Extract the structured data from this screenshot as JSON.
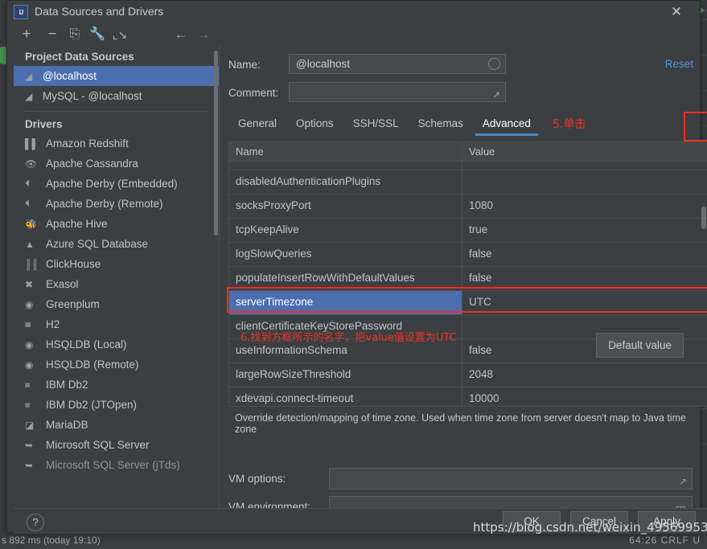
{
  "window": {
    "title": "Data Sources and Drivers",
    "app_icon": "IJ",
    "close_icon": "close-icon"
  },
  "toolbar": {
    "icons": [
      {
        "name": "add-icon",
        "glyph": "+"
      },
      {
        "name": "remove-icon",
        "glyph": "−"
      },
      {
        "name": "copy-icon",
        "glyph": "⎘"
      },
      {
        "name": "wrench-icon",
        "glyph": "ὒ7"
      },
      {
        "name": "import-icon",
        "glyph": "⬋"
      },
      {
        "name": "back-arrow-icon",
        "glyph": "←"
      },
      {
        "name": "forward-arrow-icon",
        "glyph": "→"
      }
    ]
  },
  "sidebar": {
    "project_group_label": "Project Data Sources",
    "data_sources": [
      {
        "label": "@localhost",
        "selected": true
      },
      {
        "label": "MySQL - @localhost",
        "selected": false
      }
    ],
    "drivers_group_label": "Drivers",
    "drivers": [
      {
        "label": "Amazon Redshift",
        "icon": "redshift-icon"
      },
      {
        "label": "Apache Cassandra",
        "icon": "cassandra-icon"
      },
      {
        "label": "Apache Derby (Embedded)",
        "icon": "derby-icon"
      },
      {
        "label": "Apache Derby (Remote)",
        "icon": "derby-icon"
      },
      {
        "label": "Apache Hive",
        "icon": "hive-icon"
      },
      {
        "label": "Azure SQL Database",
        "icon": "azure-icon"
      },
      {
        "label": "ClickHouse",
        "icon": "clickhouse-icon"
      },
      {
        "label": "Exasol",
        "icon": "exasol-icon"
      },
      {
        "label": "Greenplum",
        "icon": "greenplum-icon"
      },
      {
        "label": "H2",
        "icon": "h2-icon"
      },
      {
        "label": "HSQLDB (Local)",
        "icon": "hsqldb-icon"
      },
      {
        "label": "HSQLDB (Remote)",
        "icon": "hsqldb-icon"
      },
      {
        "label": "IBM Db2",
        "icon": "db2-icon"
      },
      {
        "label": "IBM Db2 (JTOpen)",
        "icon": "db2-icon"
      },
      {
        "label": "MariaDB",
        "icon": "mariadb-icon"
      },
      {
        "label": "Microsoft SQL Server",
        "icon": "mssql-icon"
      },
      {
        "label": "Microsoft SQL Server (jTds)",
        "icon": "mssql-icon"
      }
    ]
  },
  "form": {
    "name_label": "Name:",
    "name_value": "@localhost",
    "name_placeholder": "",
    "comment_label": "Comment:",
    "comment_value": "",
    "comment_placeholder": "",
    "reset_label": "Reset"
  },
  "tabs": [
    {
      "label": "General",
      "active": false
    },
    {
      "label": "Options",
      "active": false
    },
    {
      "label": "SSH/SSL",
      "active": false
    },
    {
      "label": "Schemas",
      "active": false
    },
    {
      "label": "Advanced",
      "active": true
    }
  ],
  "annotations": [
    {
      "id": "step5",
      "text": "5.单击"
    },
    {
      "id": "step6",
      "text": "6.找到方框所示的名字，把value值设置为UTC"
    }
  ],
  "table": {
    "columns": [
      "Name",
      "Value"
    ],
    "rows": [
      {
        "name": "",
        "value": "",
        "selected": false,
        "partial": true
      },
      {
        "name": "disabledAuthenticationPlugins",
        "value": "",
        "selected": false
      },
      {
        "name": "socksProxyPort",
        "value": "1080",
        "selected": false
      },
      {
        "name": "tcpKeepAlive",
        "value": "true",
        "selected": false
      },
      {
        "name": "logSlowQueries",
        "value": "false",
        "selected": false
      },
      {
        "name": "populateInsertRowWithDefaultValues",
        "value": "false",
        "selected": false
      },
      {
        "name": "serverTimezone",
        "value": "UTC",
        "selected": true
      },
      {
        "name": "clientCertificateKeyStorePassword",
        "value": "",
        "selected": false
      },
      {
        "name": "useInformationSchema",
        "value": "false",
        "selected": false
      },
      {
        "name": "largeRowSizeThreshold",
        "value": "2048",
        "selected": false
      },
      {
        "name": "xdevapi.connect-timeout",
        "value": "10000",
        "selected": false
      }
    ],
    "default_value_button": "Default value"
  },
  "description": "Override detection/mapping of time zone. Used when time zone from server doesn't map to Java time zone",
  "vm": {
    "options_label": "VM options:",
    "options_value": "",
    "environment_label": "VM environment:",
    "environment_value": ""
  },
  "footer": {
    "help_label": "?",
    "ok_label": "OK",
    "cancel_label": "Cancel",
    "apply_label": "Apply"
  },
  "watermark": "https://blog.csdn.net/weixin_49569953",
  "status_bar": {
    "left_text": "s 892 ms (today 19:10)",
    "right_text": "64:26   CRLF   U"
  },
  "colors": {
    "accent_blue": "#4b6eaf",
    "link_blue": "#5294e2",
    "highlight_red": "#ee2d24",
    "panel_bg": "#3c3f41",
    "tab_underline": "#4a88c7"
  }
}
